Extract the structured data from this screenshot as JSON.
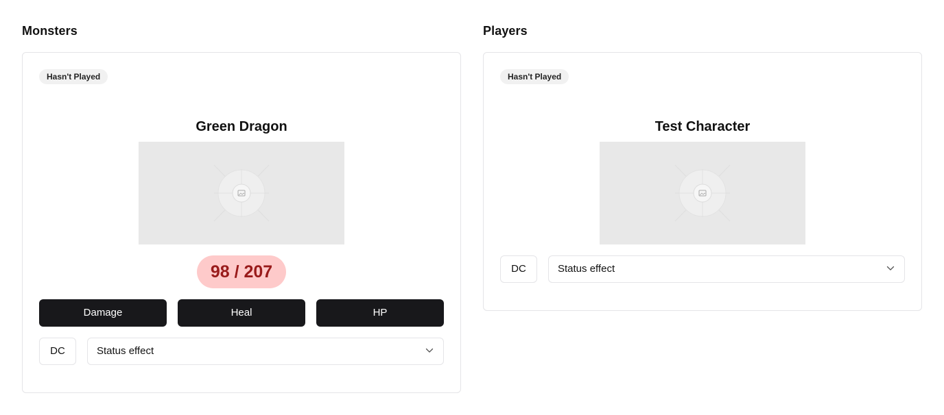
{
  "monsters": {
    "heading": "Monsters",
    "card": {
      "badge": "Hasn't Played",
      "name": "Green Dragon",
      "hp_text": "98 / 207",
      "buttons": {
        "damage": "Damage",
        "heal": "Heal",
        "hp": "HP"
      },
      "dc_label": "DC",
      "status_select": "Status effect"
    }
  },
  "players": {
    "heading": "Players",
    "card": {
      "badge": "Hasn't Played",
      "name": "Test Character",
      "dc_label": "DC",
      "status_select": "Status effect"
    }
  },
  "colors": {
    "hp_pill_bg": "#fecaca",
    "hp_pill_text": "#991b1b",
    "button_dark": "#18181b",
    "image_placeholder": "#e8e8e8"
  },
  "icons": {
    "portrait": "image-placeholder-icon",
    "select_chevron": "chevron-down-icon"
  }
}
